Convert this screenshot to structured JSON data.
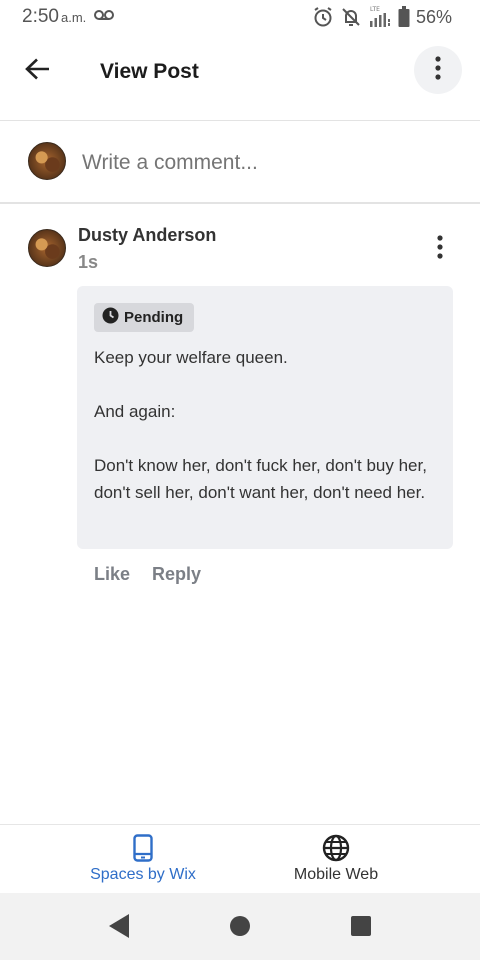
{
  "status_bar": {
    "time": "2:50",
    "ampm": "a.m.",
    "battery_percent": "56%",
    "icons": [
      "voicemail-icon",
      "alarm-icon",
      "notifications-off-icon",
      "lte-signal-icon",
      "battery-icon"
    ]
  },
  "app_bar": {
    "title": "View Post",
    "back_icon": "arrow-left-icon",
    "more_icon": "more-vertical-icon"
  },
  "composer": {
    "placeholder": "Write a comment..."
  },
  "comment": {
    "author": "Dusty Anderson",
    "time": "1s",
    "status": "Pending",
    "paragraphs": [
      "Keep your welfare queen.",
      "",
      "And again:",
      "",
      "Don't know her, don't fuck her, don't buy her, don't sell her, don't want her, don't need her."
    ],
    "actions": {
      "like": "Like",
      "reply": "Reply"
    }
  },
  "tabs": [
    {
      "label": "Spaces by Wix",
      "icon": "phone-icon",
      "active": true
    },
    {
      "label": "Mobile Web",
      "icon": "globe-icon",
      "active": false
    }
  ],
  "colors": {
    "accent": "#2f6ec8",
    "bubble": "#eff0f3",
    "badge": "#d7d8dc",
    "muted": "#7b7f86"
  }
}
